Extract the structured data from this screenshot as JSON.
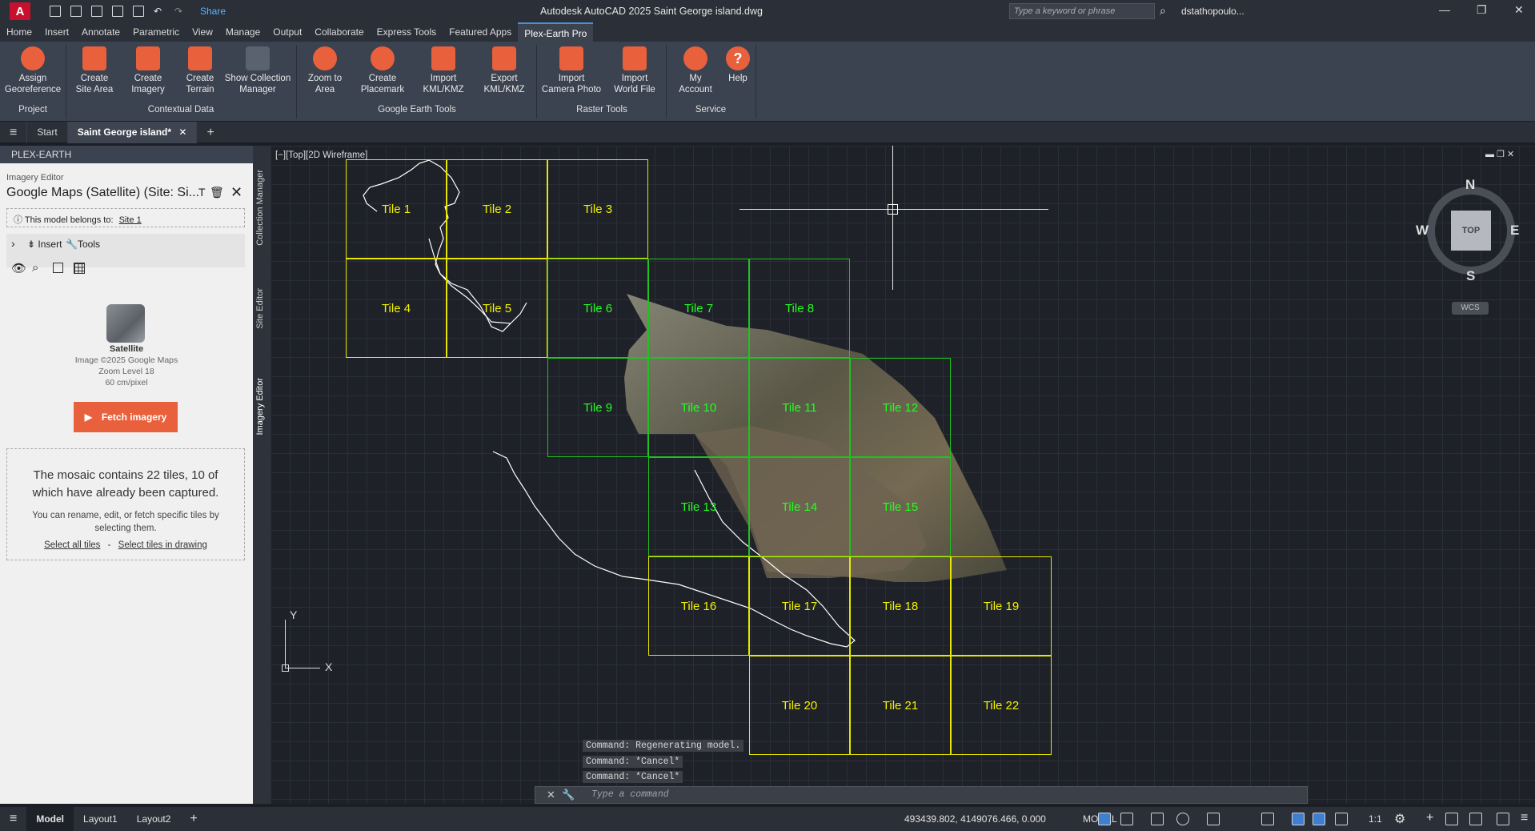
{
  "titlebar": {
    "app_letter": "A",
    "share": "Share",
    "title": "Autodesk AutoCAD 2025    Saint George island.dwg",
    "search_placeholder": "Type a keyword or phrase",
    "user": "dstathopoulo..."
  },
  "menu_tabs": [
    "Home",
    "Insert",
    "Annotate",
    "Parametric",
    "View",
    "Manage",
    "Output",
    "Collaborate",
    "Express Tools",
    "Featured Apps",
    "Plex-Earth Pro"
  ],
  "ribbon": {
    "buttons": [
      {
        "l1": "Assign",
        "l2": "Georeference"
      },
      {
        "l1": "Create",
        "l2": "Site Area"
      },
      {
        "l1": "Create",
        "l2": "Imagery"
      },
      {
        "l1": "Create",
        "l2": "Terrain"
      },
      {
        "l1": "Show Collection",
        "l2": "Manager"
      },
      {
        "l1": "Zoom to",
        "l2": "Area"
      },
      {
        "l1": "Create",
        "l2": "Placemark"
      },
      {
        "l1": "Import",
        "l2": "KML/KMZ"
      },
      {
        "l1": "Export",
        "l2": "KML/KMZ"
      },
      {
        "l1": "Import",
        "l2": "Camera Photo"
      },
      {
        "l1": "Import",
        "l2": "World File"
      },
      {
        "l1": "My",
        "l2": "Account"
      },
      {
        "l1": "Help",
        "l2": ""
      }
    ],
    "groups": [
      "Project",
      "Contextual Data",
      "Google Earth Tools",
      "Raster Tools",
      "Service"
    ]
  },
  "doc_tabs": {
    "start": "Start",
    "active": "Saint George island*"
  },
  "panel": {
    "header": "PLEX-EARTH",
    "editor_title": "Imagery Editor",
    "imagery_name": "Google Maps (Satellite) (Site: Si...",
    "belongs_label": "This model belongs to:",
    "belongs_link": "Site 1",
    "insert": "Insert",
    "tools": "Tools",
    "thumb_label": "Satellite",
    "image_credit": "Image ©2025 Google Maps",
    "zoom": "Zoom Level 18",
    "resolution": "60 cm/pixel",
    "fetch": "Fetch imagery",
    "mosaic_text": "The mosaic contains 22 tiles, 10 of which have already been captured.",
    "hint": "You can rename, edit, or fetch specific tiles by selecting them.",
    "select_all": "Select all tiles",
    "sep": "-",
    "select_drawing": "Select tiles in drawing"
  },
  "side_tabs": [
    "Collection Manager",
    "Site Editor",
    "Imagery Editor"
  ],
  "viewport": {
    "label": "[−][Top][2D Wireframe]"
  },
  "tiles": [
    "Tile 1",
    "Tile 2",
    "Tile 3",
    "Tile 4",
    "Tile 5",
    "Tile 6",
    "Tile 7",
    "Tile 8",
    "Tile 9",
    "Tile 10",
    "Tile 11",
    "Tile 12",
    "Tile 13",
    "Tile 14",
    "Tile 15",
    "Tile 16",
    "Tile 17",
    "Tile 18",
    "Tile 19",
    "Tile 20",
    "Tile 21",
    "Tile 22"
  ],
  "viewcube": {
    "n": "N",
    "s": "S",
    "e": "E",
    "w": "W",
    "top": "TOP",
    "wcs": "WCS"
  },
  "ucs": {
    "x": "X",
    "y": "Y"
  },
  "command": {
    "history": [
      "Command: Regenerating model.",
      "Command: *Cancel*",
      "Command: *Cancel*"
    ],
    "placeholder": "Type a command"
  },
  "status": {
    "model_tab": "Model",
    "layout1": "Layout1",
    "layout2": "Layout2",
    "coords": "493439.802, 4149076.466, 0.000",
    "model": "MODEL",
    "scale": "1:1"
  },
  "colors": {
    "accent": "#e8603c",
    "tile_yellow": "#e6e600",
    "tile_green": "#1fc21f"
  }
}
